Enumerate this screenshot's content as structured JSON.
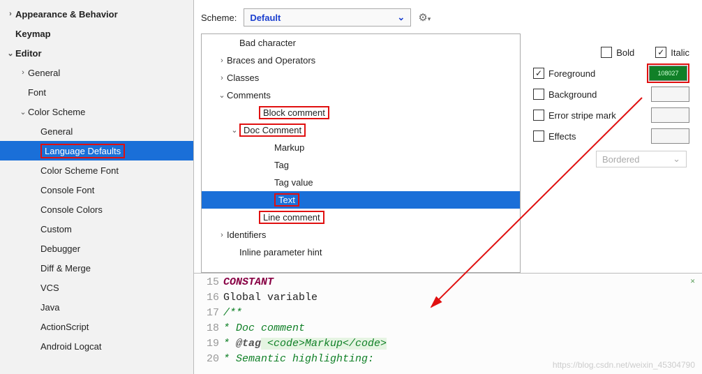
{
  "sidebar": [
    {
      "label": "Appearance & Behavior",
      "indent": 0,
      "bold": true,
      "chev": ">"
    },
    {
      "label": "Keymap",
      "indent": 0,
      "bold": true,
      "chev": ""
    },
    {
      "label": "Editor",
      "indent": 0,
      "bold": true,
      "chev": "v"
    },
    {
      "label": "General",
      "indent": 1,
      "bold": false,
      "chev": ">"
    },
    {
      "label": "Font",
      "indent": 1,
      "bold": false,
      "chev": ""
    },
    {
      "label": "Color Scheme",
      "indent": 1,
      "bold": false,
      "chev": "v"
    },
    {
      "label": "General",
      "indent": 2,
      "bold": false,
      "chev": ""
    },
    {
      "label": "Language Defaults",
      "indent": 2,
      "bold": false,
      "chev": "",
      "sel": true,
      "red": true
    },
    {
      "label": "Color Scheme Font",
      "indent": 2,
      "bold": false,
      "chev": ""
    },
    {
      "label": "Console Font",
      "indent": 2,
      "bold": false,
      "chev": ""
    },
    {
      "label": "Console Colors",
      "indent": 2,
      "bold": false,
      "chev": ""
    },
    {
      "label": "Custom",
      "indent": 2,
      "bold": false,
      "chev": ""
    },
    {
      "label": "Debugger",
      "indent": 2,
      "bold": false,
      "chev": ""
    },
    {
      "label": "Diff & Merge",
      "indent": 2,
      "bold": false,
      "chev": ""
    },
    {
      "label": "VCS",
      "indent": 2,
      "bold": false,
      "chev": ""
    },
    {
      "label": "Java",
      "indent": 2,
      "bold": false,
      "chev": ""
    },
    {
      "label": "ActionScript",
      "indent": 2,
      "bold": false,
      "chev": ""
    },
    {
      "label": "Android Logcat",
      "indent": 2,
      "bold": false,
      "chev": ""
    }
  ],
  "scheme": {
    "label": "Scheme:",
    "value": "Default"
  },
  "ctree": [
    {
      "label": "Bad character",
      "indent": 1,
      "chev": ""
    },
    {
      "label": "Braces and Operators",
      "indent": 0,
      "chev": ">"
    },
    {
      "label": "Classes",
      "indent": 0,
      "chev": ">"
    },
    {
      "label": "Comments",
      "indent": 0,
      "chev": "v"
    },
    {
      "label": "Block comment",
      "indent": 2,
      "chev": "",
      "red": true
    },
    {
      "label": "Doc Comment",
      "indent": 1,
      "chev": "v",
      "red": true
    },
    {
      "label": "Markup",
      "indent": 3,
      "chev": ""
    },
    {
      "label": "Tag",
      "indent": 3,
      "chev": ""
    },
    {
      "label": "Tag value",
      "indent": 3,
      "chev": ""
    },
    {
      "label": "Text",
      "indent": 3,
      "chev": "",
      "sel": true,
      "red": true
    },
    {
      "label": "Line comment",
      "indent": 2,
      "chev": "",
      "red": true
    },
    {
      "label": "Identifiers",
      "indent": 0,
      "chev": ">"
    },
    {
      "label": "Inline parameter hint",
      "indent": 1,
      "chev": ""
    }
  ],
  "props": {
    "bold": "Bold",
    "italic": "Italic",
    "fg": "Foreground",
    "bg": "Background",
    "stripe": "Error stripe mark",
    "eff": "Effects",
    "effsel": "Bordered",
    "fghex": "108027"
  },
  "preview": [
    {
      "n": "15",
      "kind": "constant",
      "t": "CONSTANT"
    },
    {
      "n": "16",
      "kind": "plain",
      "t": "Global variable"
    },
    {
      "n": "17",
      "kind": "doc",
      "t": "/**"
    },
    {
      "n": "18",
      "kind": "doc",
      "t": " * Doc comment"
    },
    {
      "n": "19",
      "kind": "docmarkup",
      "pre": " * ",
      "tag": "@tag",
      "mk": " <code>Markup</code>"
    },
    {
      "n": "20",
      "kind": "doc",
      "t": " * Semantic highlighting:"
    }
  ],
  "watermark": "https://blog.csdn.net/weixin_45304790"
}
